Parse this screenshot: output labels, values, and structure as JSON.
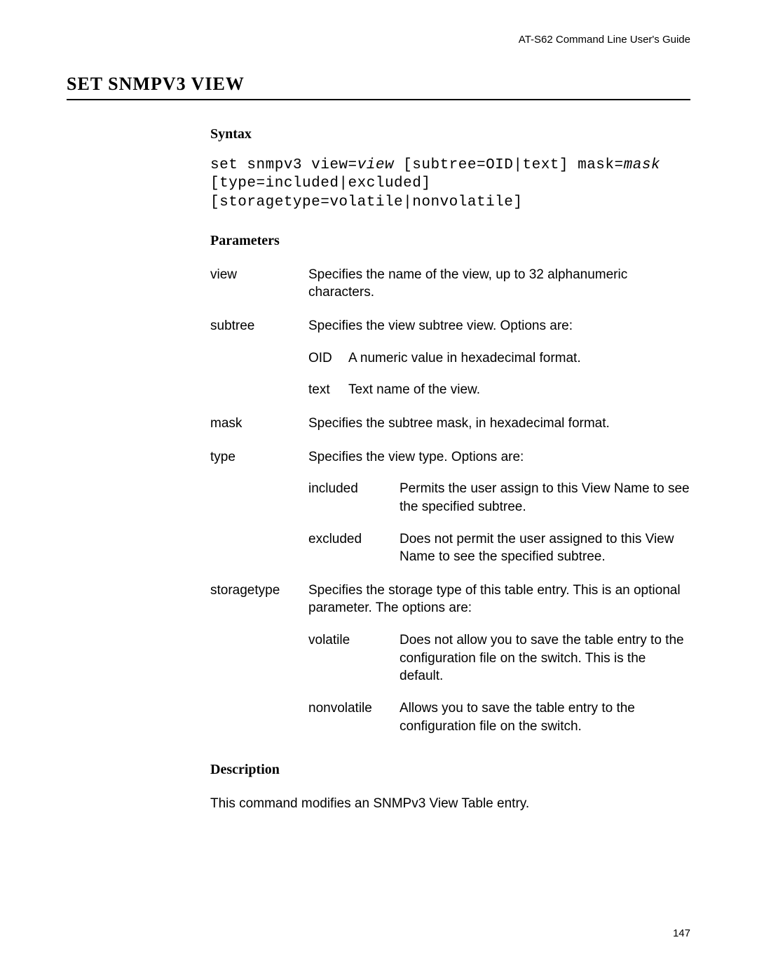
{
  "header": {
    "guide_name": "AT-S62 Command Line User's Guide"
  },
  "title": "SET SNMPV3 VIEW",
  "syntax": {
    "heading": "Syntax",
    "line1_a": "set snmpv3 view=",
    "line1_b": "view",
    "line1_c": " [subtree=OID|text] mask=",
    "line1_d": "mask",
    "line2": "[type=included|excluded]",
    "line3": "[storagetype=volatile|nonvolatile]"
  },
  "parameters": {
    "heading": "Parameters",
    "view": {
      "name": "view",
      "desc": "Specifies the name of the view, up to 32 alphanumeric characters."
    },
    "subtree": {
      "name": "subtree",
      "desc": "Specifies the view subtree view. Options are:",
      "opt1": {
        "name": "OID",
        "desc": "A numeric value in hexadecimal format."
      },
      "opt2": {
        "name": "text",
        "desc": "Text name of the view."
      }
    },
    "mask": {
      "name": "mask",
      "desc": "Specifies the subtree mask, in hexadecimal format."
    },
    "type": {
      "name": "type",
      "desc": "Specifies the view type. Options are:",
      "opt1": {
        "name": "included",
        "desc": "Permits the user assign to this View Name to see the specified subtree."
      },
      "opt2": {
        "name": "excluded",
        "desc": "Does not permit the user assigned to this View Name to see the specified subtree."
      }
    },
    "storagetype": {
      "name": "storagetype",
      "desc": "Specifies the storage type of this table entry. This is an optional parameter. The options are:",
      "opt1": {
        "name": "volatile",
        "desc": "Does not allow you to save the table entry to the configuration file on the switch. This is the default."
      },
      "opt2": {
        "name": "nonvolatile",
        "desc": "Allows you to save the table entry to the configuration file on the switch."
      }
    }
  },
  "description": {
    "heading": "Description",
    "text": "This command modifies an SNMPv3 View Table entry."
  },
  "page_number": "147"
}
